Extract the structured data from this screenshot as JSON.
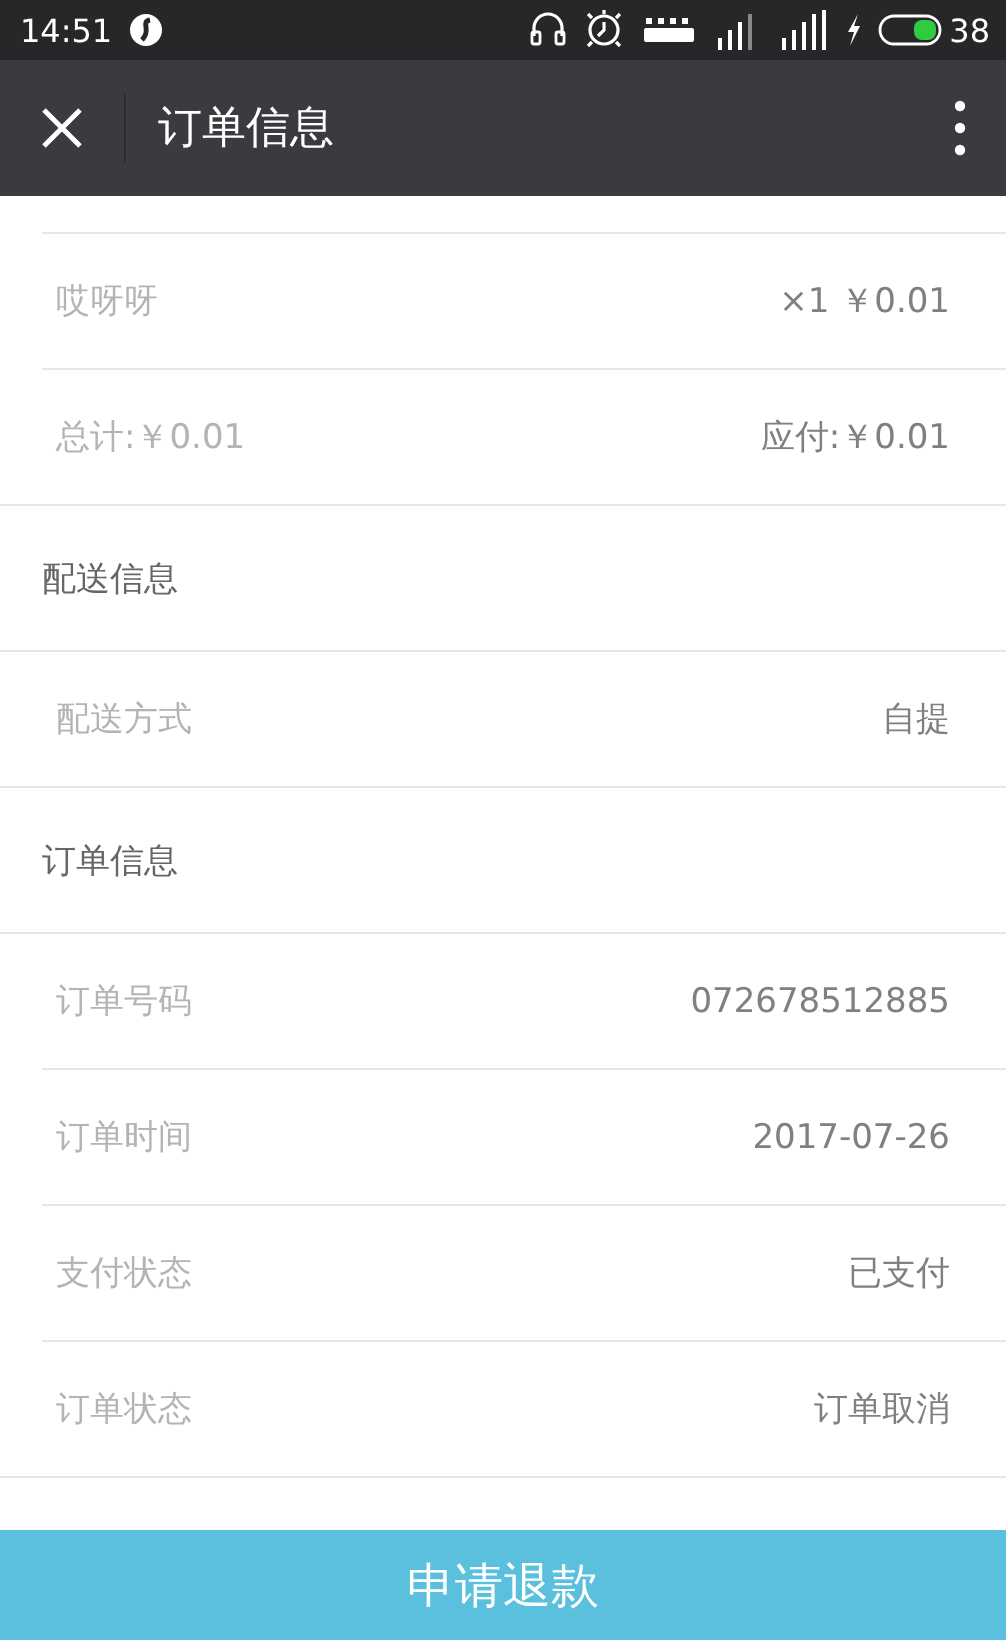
{
  "status_bar": {
    "time": "14:51",
    "battery": "38"
  },
  "app_bar": {
    "title": "订单信息"
  },
  "sections": [
    {
      "rows": [
        {
          "label": "哎呀呀",
          "value": "×1 ￥0.01"
        },
        {
          "label": "总计:￥0.01",
          "value": "应付:￥0.01"
        }
      ]
    },
    {
      "header": "配送信息",
      "rows": [
        {
          "label": "配送方式",
          "value": "自提"
        }
      ]
    },
    {
      "header": "订单信息",
      "rows": [
        {
          "label": "订单号码",
          "value": "072678512885"
        },
        {
          "label": "订单时间",
          "value": "2017-07-26"
        },
        {
          "label": "支付状态",
          "value": "已支付"
        },
        {
          "label": "订单状态",
          "value": "订单取消"
        }
      ]
    }
  ],
  "refund_button": "申请退款"
}
